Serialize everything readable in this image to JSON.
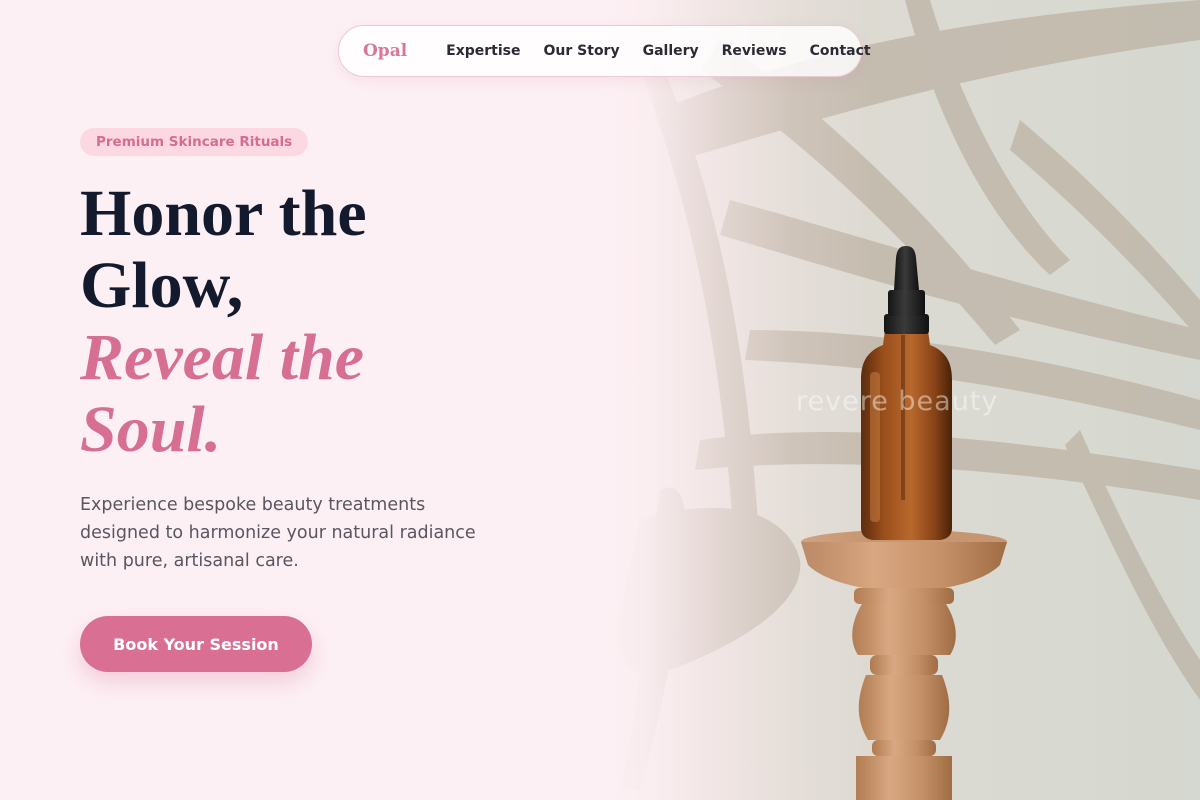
{
  "nav": {
    "logo": "Opal",
    "links": [
      "Expertise",
      "Our Story",
      "Gallery",
      "Reviews",
      "Contact"
    ]
  },
  "hero": {
    "badge": "Premium Skincare Rituals",
    "headline": {
      "line1": "Honor the",
      "line2": "Glow,",
      "line3": "Reveal the",
      "line4": "Soul."
    },
    "description": {
      "line1": "Experience bespoke beauty treatments",
      "line2": "designed to harmonize your natural radiance",
      "line3": "with pure, artisanal care."
    },
    "cta_label": "Book Your Session",
    "image": {
      "watermark": "revere beauty",
      "subject": "amber-dropper-bottle-on-wooden-pedestal"
    }
  },
  "colors": {
    "page_background": "#fdf0f4",
    "accent_pink": "#d96f93",
    "badge_background": "#fbd8e2",
    "heading_dark": "#141a2e",
    "body_text": "#5a5660"
  }
}
